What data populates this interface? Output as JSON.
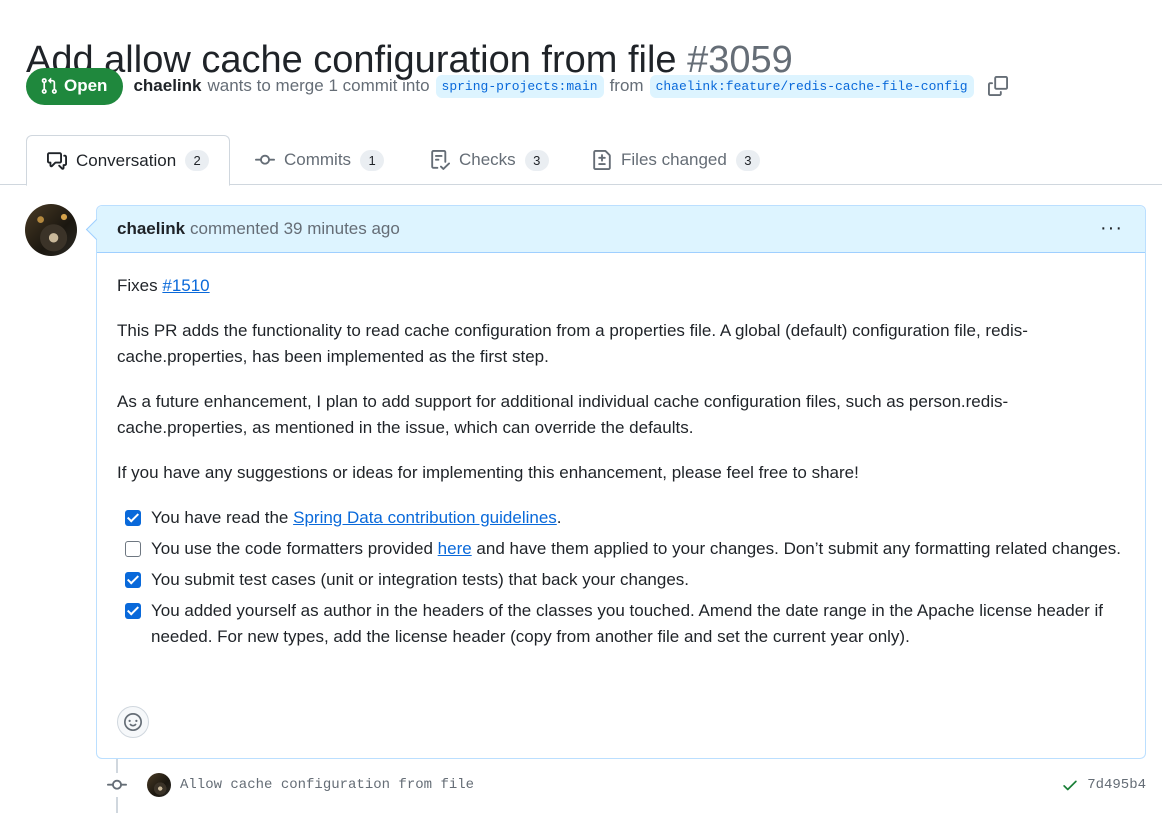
{
  "pr": {
    "title": "Add allow cache configuration from file",
    "number": "#3059",
    "state": "Open",
    "author": "chaelink",
    "merge_text": "wants to merge 1 commit into",
    "base_branch": "spring-projects:main",
    "from_text": "from",
    "head_branch": "chaelink:feature/redis-cache-file-config"
  },
  "tabs": [
    {
      "label": "Conversation",
      "count": "2",
      "icon": "comment-discussion-icon"
    },
    {
      "label": "Commits",
      "count": "1",
      "icon": "git-commit-icon"
    },
    {
      "label": "Checks",
      "count": "3",
      "icon": "checklist-icon"
    },
    {
      "label": "Files changed",
      "count": "3",
      "icon": "file-diff-icon"
    }
  ],
  "comment": {
    "author": "chaelink",
    "meta": "commented 39 minutes ago",
    "more": "···",
    "fixes_text": "Fixes",
    "fixes_link": "#1510",
    "para1": "This PR adds the functionality to read cache configuration from a properties file. A global (default) configuration file, redis-cache.properties, has been implemented as the first step.",
    "para2": "As a future enhancement, I plan to add support for additional individual cache configuration files, such as person.redis-cache.properties, as mentioned in the issue, which can override the defaults.",
    "para3": "If you have any suggestions or ideas for implementing this enhancement, please feel free to share!",
    "checklist": [
      {
        "checked": true,
        "pre": "You have read the ",
        "link": "Spring Data contribution guidelines",
        "post": "."
      },
      {
        "checked": false,
        "pre": "You use the code formatters provided ",
        "link": "here",
        "post": " and have them applied to your changes. Don’t submit any formatting related changes."
      },
      {
        "checked": true,
        "pre": "You submit test cases (unit or integration tests) that back your changes.",
        "link": "",
        "post": ""
      },
      {
        "checked": true,
        "pre": "You added yourself as author in the headers of the classes you touched. Amend the date range in the Apache license header if needed. For new types, add the license header (copy from another file and set the current year only).",
        "link": "",
        "post": ""
      }
    ]
  },
  "commit": {
    "message": "Allow cache configuration from file",
    "sha": "7d495b4",
    "status_color": "#1a7f37"
  },
  "colors": {
    "accent": "#0969da",
    "open_green": "#1f883d",
    "header_bg": "#ddf4ff"
  }
}
